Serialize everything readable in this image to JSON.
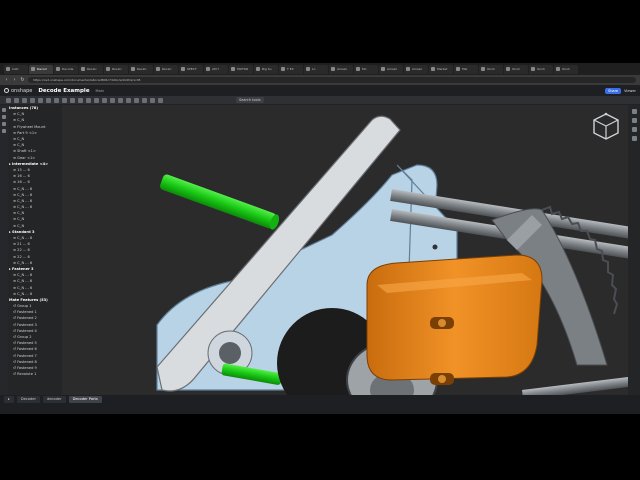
{
  "browser": {
    "tabs": [
      {
        "label": "CAD",
        "active": false
      },
      {
        "label": "Decod",
        "active": true
      },
      {
        "label": "Decode",
        "active": false
      },
      {
        "label": "Recalc",
        "active": false
      },
      {
        "label": "Recalc",
        "active": false
      },
      {
        "label": "Recalc",
        "active": false
      },
      {
        "label": "Recalc",
        "active": false
      },
      {
        "label": "SPECT",
        "active": false
      },
      {
        "label": "AM f",
        "active": false
      },
      {
        "label": "MOTOR",
        "active": false
      },
      {
        "label": "Big Su",
        "active": false
      },
      {
        "label": "T EX",
        "active": false
      },
      {
        "label": "Lo",
        "active": false
      },
      {
        "label": "Amazo",
        "active": false
      },
      {
        "label": "Mo",
        "active": false
      },
      {
        "label": "Amazo",
        "active": false
      },
      {
        "label": "Amazo",
        "active": false
      },
      {
        "label": "Market",
        "active": false
      },
      {
        "label": "Mar",
        "active": false
      },
      {
        "label": "Onsh",
        "active": false
      },
      {
        "label": "Onsh",
        "active": false
      },
      {
        "label": "Onsh",
        "active": false
      },
      {
        "label": "Onsh",
        "active": false
      }
    ],
    "url": "https://cad.onshape.com/documents/2a6ccad8b5c74d4c/w/9c0f/e/1c05"
  },
  "app": {
    "logo_text": "onshape",
    "doc_title": "Decode Example",
    "branch": "Main",
    "share_label": "Share",
    "user_label": "Viewer"
  },
  "toolbar": {
    "search_tools": "Search tools"
  },
  "panel": {
    "rows": [
      {
        "label": "Instances (78)",
        "head": true
      },
      {
        "label": "≡ C_N"
      },
      {
        "label": "≡ C_N"
      },
      {
        "label": "≡ Flywheel Mount"
      },
      {
        "label": "≡ Part 9 <1>"
      },
      {
        "label": "≡ C_N"
      },
      {
        "label": "≡ C_N"
      },
      {
        "label": "≡ Shaft <1>"
      },
      {
        "label": "≡ Gear <1>"
      },
      {
        "label": "▸ intermediate <4>",
        "head": true
      },
      {
        "label": "≡ 15 ... 6"
      },
      {
        "label": "≡ 16 ... 6"
      },
      {
        "label": "≡ 16 ... 6"
      },
      {
        "label": "≡ C_N ... 6"
      },
      {
        "label": "≡ C_N ... 6"
      },
      {
        "label": "≡ C_N ... 6"
      },
      {
        "label": "≡ C_N ... 6"
      },
      {
        "label": "≡ C_N"
      },
      {
        "label": "≡ C_N"
      },
      {
        "label": "≡ C_N"
      },
      {
        "label": "▸ Standard 3",
        "head": true
      },
      {
        "label": "≡ C_N ... 6"
      },
      {
        "label": "≡ 21 ... 6"
      },
      {
        "label": "≡ 22 ... 6"
      },
      {
        "label": "≡ 22 ... 6"
      },
      {
        "label": "≡ C_N ... 6"
      },
      {
        "label": "▸ Fastener 3",
        "head": true
      },
      {
        "label": "≡ C_N ... 6"
      },
      {
        "label": "≡ C_N ... 6"
      },
      {
        "label": "≡ C_N ... 6"
      },
      {
        "label": "≡ C_N ... 6"
      },
      {
        "label": "Mate Features (53)",
        "head": true
      },
      {
        "label": "↺ Group 1"
      },
      {
        "label": "↺ Fastened 1"
      },
      {
        "label": "↺ Fastened 2"
      },
      {
        "label": "↺ Fastened 3"
      },
      {
        "label": "↺ Fastened 4"
      },
      {
        "label": "↺ Group 2"
      },
      {
        "label": "↺ Fastened 5"
      },
      {
        "label": "↺ Fastened 6"
      },
      {
        "label": "↺ Fastened 7"
      },
      {
        "label": "↺ Fastened 8"
      },
      {
        "label": "↺ Fastened 9"
      },
      {
        "label": "↺ Revolute 1"
      }
    ]
  },
  "bottom_tabs": [
    {
      "label": "▸",
      "active": false
    },
    {
      "label": "Decoder",
      "active": false
    },
    {
      "label": "decoder",
      "active": false
    },
    {
      "label": "Decoder Parts",
      "active": true
    }
  ],
  "colors": {
    "plate": "#b9d3e6",
    "arm": "#d9dcdf",
    "green_shaft": "#22d21e",
    "orange_block": "#e58516",
    "rod": "#8f9499"
  }
}
